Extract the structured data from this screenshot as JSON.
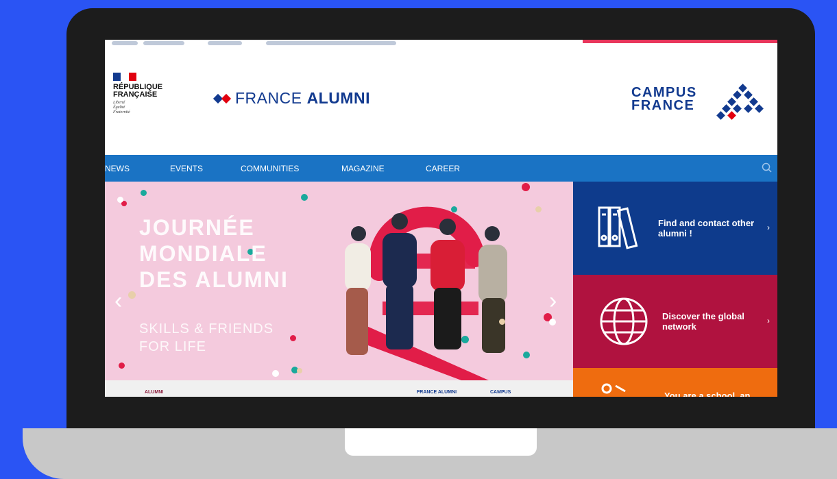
{
  "colors": {
    "page_bg": "#2a54f4",
    "navy": "#123a8f",
    "nav_blue": "#1a73c4",
    "tile_blue": "#0e3b8c",
    "tile_red": "#b0123f",
    "tile_orange": "#ef6c0f",
    "hero_pink": "#f4cadd",
    "accent_red": "#e8365c",
    "teal": "#1aa99c"
  },
  "header": {
    "republique": {
      "name": "RÉPUBLIQUE\nFRANÇAISE",
      "motto": "Liberté\nÉgalité\nFraternité"
    },
    "france_alumni": {
      "word1": "FRANCE",
      "word2": "ALUMNI"
    },
    "campus_france": {
      "line1": "CAMPUS",
      "line2": "FRANCE"
    }
  },
  "nav": {
    "items": [
      {
        "label": "NEWS"
      },
      {
        "label": "EVENTS"
      },
      {
        "label": "COMMUNITIES"
      },
      {
        "label": "MAGAZINE"
      },
      {
        "label": "CAREER"
      }
    ],
    "search_icon": "search-icon"
  },
  "hero": {
    "title": "JOURNÉE\nMONDIALE\nDES ALUMNI",
    "subtitle": "SKILLS & FRIENDS\nFOR LIFE",
    "prev_icon": "chevron-left-icon",
    "next_icon": "chevron-right-icon"
  },
  "tiles": [
    {
      "label": "Find and contact other\nalumni !",
      "icon": "binders-icon"
    },
    {
      "label": "Discover the global\nnetwork",
      "icon": "globe-icon"
    },
    {
      "label": "You are a school, an",
      "icon": "location-pin-icon"
    }
  ],
  "footer_strip": {
    "left": "ALUMNI",
    "mid": "FRANCE ALUMNI",
    "right": "CAMPUS"
  }
}
